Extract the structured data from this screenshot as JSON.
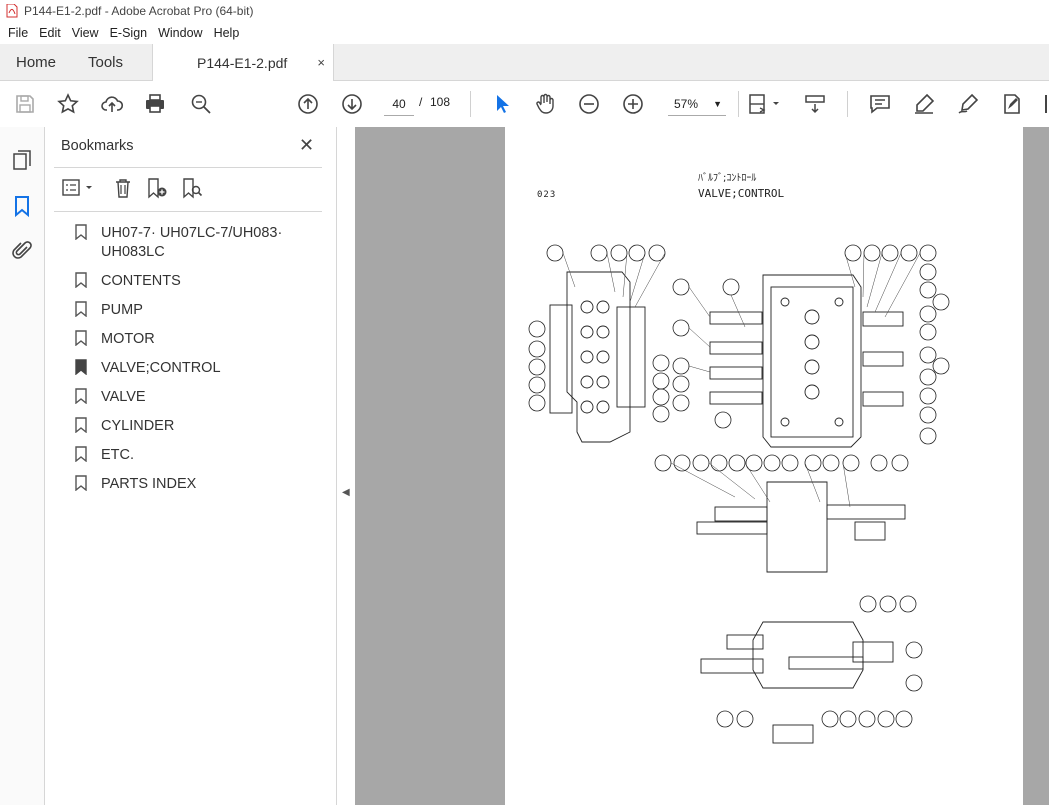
{
  "window": {
    "title": "P144-E1-2.pdf - Adobe Acrobat Pro (64-bit)",
    "pdf_icon_color": "#d32f2f"
  },
  "menu": [
    "File",
    "Edit",
    "View",
    "E-Sign",
    "Window",
    "Help"
  ],
  "tabs": {
    "home": "Home",
    "tools": "Tools",
    "document": "P144-E1-2.pdf",
    "close": "×"
  },
  "toolbar": {
    "page_current": "40",
    "page_sep": "/",
    "page_total": "108",
    "zoom": "57%",
    "icons": [
      "save-icon",
      "star-icon",
      "upload-icon",
      "print-icon",
      "zoom-search-icon",
      "page-up-icon",
      "page-down-icon",
      "select-cursor-icon",
      "hand-icon",
      "zoom-out-icon",
      "zoom-in-icon",
      "page-layout-icon",
      "scroll-mode-icon",
      "comment-icon",
      "highlight-icon",
      "sign-icon",
      "edit-pdf-icon"
    ],
    "accent": "#1473e6"
  },
  "bookmarks": {
    "title": "Bookmarks",
    "close": "✕",
    "items": [
      "UH07-7· UH07LC-7/UH083· UH083LC",
      "CONTENTS",
      "PUMP",
      "MOTOR",
      "VALVE;CONTROL",
      "VALVE",
      "CYLINDER",
      "ETC.",
      "PARTS INDEX"
    ]
  },
  "document": {
    "title_jp": "ﾊﾞﾙﾌﾞ;ｺﾝﾄﾛｰﾙ",
    "title_en": "VALVE;CONTROL",
    "page_number": "023"
  }
}
